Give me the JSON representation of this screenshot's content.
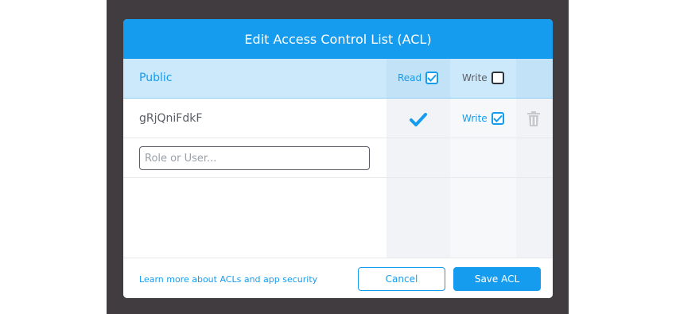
{
  "dialog": {
    "title": "Edit Access Control List (ACL)"
  },
  "public_row": {
    "label": "Public",
    "read_label": "Read",
    "read_checked": true,
    "write_label": "Write",
    "write_checked": false
  },
  "user_row": {
    "name": "gRjQniFdkF",
    "read_granted": true,
    "write_label": "Write",
    "write_checked": true,
    "delete_icon": "trash-icon"
  },
  "new_entry": {
    "value": "",
    "placeholder": "Role or User..."
  },
  "footer": {
    "learn_more": "Learn more about ACLs and app security",
    "cancel_label": "Cancel",
    "save_label": "Save ACL"
  },
  "colors": {
    "accent": "#169cee",
    "backdrop": "#403c3f",
    "public_row_bg": "#cbe9fb",
    "text_dark": "#5b5d66"
  }
}
